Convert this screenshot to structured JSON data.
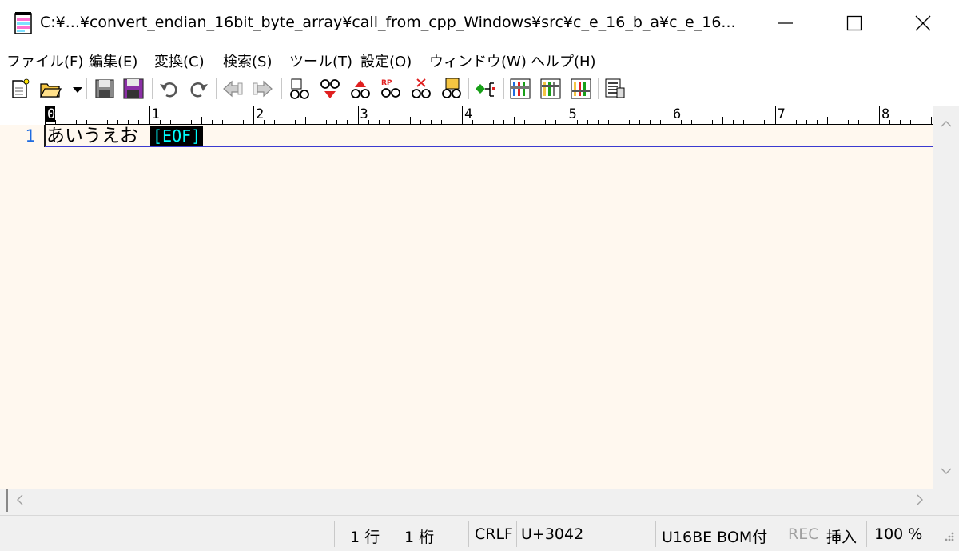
{
  "window": {
    "title": "C:¥...¥convert_endian_16bit_byte_array¥call_from_cpp_Windows¥src¥c_e_16_b_a¥c_e_16...",
    "controls": {
      "minimize": "minimize-icon",
      "maximize": "maximize-icon",
      "close": "close-icon"
    }
  },
  "menu": [
    "ファイル(F)",
    "編集(E)",
    "変換(C)",
    "検索(S)",
    "ツール(T)",
    "設定(O)",
    "ウィンドウ(W)",
    "ヘルプ(H)"
  ],
  "toolbar": {
    "buttons": [
      "new-file-icon",
      "open-file-icon",
      "open-dropdown-icon",
      "save-icon",
      "save-all-icon",
      "undo-icon",
      "redo-icon",
      "jump-back-icon",
      "jump-forward-icon",
      "find-icon",
      "find-next-icon",
      "find-prev-icon",
      "replace-icon",
      "clear-mark-icon",
      "grep-icon",
      "outline-icon",
      "settings-common-icon",
      "settings-type-icon",
      "settings-font-icon",
      "window-list-icon"
    ]
  },
  "ruler": {
    "labels": [
      "0",
      "1",
      "2",
      "3",
      "4",
      "5",
      "6",
      "7",
      "8"
    ]
  },
  "editor": {
    "colors": {
      "background": "#fff8ef",
      "line_number": "#1e6be0",
      "eof_fg": "#00ffff",
      "eof_bg": "#000000",
      "cursor_line": "#3a3ad0"
    },
    "lines": [
      {
        "number": "1",
        "text": "あいうえお"
      }
    ],
    "eof_marker": "[EOF]"
  },
  "status": {
    "row": "1 行",
    "col": "1 桁",
    "line_ending": "CRLF",
    "char_code": "U+3042",
    "encoding": "U16BE BOM付",
    "rec": "REC",
    "mode": "挿入",
    "zoom": "100 %"
  }
}
